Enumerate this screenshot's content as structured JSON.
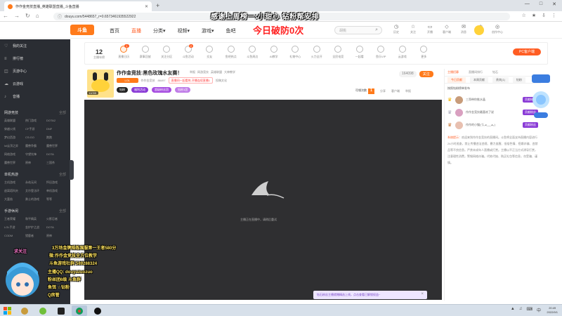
{
  "browser": {
    "tab_title": "作作金竞技直播_英雄联盟直播_斗鱼直播",
    "url": "douyu.com/5448657_r=0.6573461935522922",
    "url_prefix": "ⓘ",
    "new_tab": "+",
    "window_controls": [
      "—",
      "□",
      "✕"
    ],
    "nav": [
      "←",
      "→",
      "↻",
      "⌂"
    ],
    "right_icons": [
      "☆",
      "★",
      "⇩",
      "⋮"
    ]
  },
  "overlay": {
    "line1": "感谢上周榜一:小甜心   钻粉帮安排",
    "line2": "今日破防0次"
  },
  "header": {
    "logo": "斗鱼",
    "nav": [
      "首页",
      "直播",
      "分类▾",
      "视频▾",
      "游戏▾",
      "鱼吧"
    ],
    "active_nav": 1,
    "search_placeholder": "胡桃",
    "search_icon": "⌕",
    "icons": [
      {
        "glyph": "◷",
        "label": "历史"
      },
      {
        "glyph": "☆",
        "label": "关注"
      },
      {
        "glyph": "▭",
        "label": "开播"
      },
      {
        "glyph": "◇",
        "label": "客户端"
      },
      {
        "glyph": "✉",
        "label": "消息"
      },
      {
        "glyph": "♔",
        "label": "贵族"
      },
      {
        "glyph": "◎",
        "label": "创作中心"
      }
    ]
  },
  "sidebar": {
    "top": [
      {
        "icon": "♡",
        "label": "我的关注"
      },
      {
        "icon": "≡",
        "label": "排行榜"
      },
      {
        "icon": "◫",
        "label": "页游中心"
      },
      {
        "icon": "☁",
        "label": "云游戏"
      },
      {
        "icon": "♪",
        "label": "音播"
      }
    ],
    "sections": [
      {
        "title": "网游竞技",
        "more": "全部",
        "items": [
          "英雄联盟",
          "热门游戏",
          "DOTA2",
          "穿越火线",
          "CF手游",
          "DNF",
          "梦幻西游",
          "CS:GO",
          "跑跑",
          "lol云顶之弈",
          "魔兽争霸",
          "魔兽世界",
          "网络游戏",
          "守望先锋",
          "DOTA",
          "魔兽世界",
          "原神",
          "三国杀"
        ]
      },
      {
        "title": "单机热游",
        "more": "全部",
        "items": [
          "主机游戏",
          "永劫无间",
          "怀旧游戏",
          "逃离塔科夫",
          "艾尔登法环",
          "单机游戏",
          "大富翁",
          "勇士的游戏",
          "等等"
        ]
      },
      {
        "title": "手游休闲",
        "more": "全部",
        "items": [
          "王者荣耀",
          "和平精英",
          "火影忍者",
          "LOL手游",
          "金铲铲之战",
          "DOTA",
          "CODM",
          "猎鹿者",
          "原神"
        ]
      }
    ],
    "handle_glyph": "‹"
  },
  "categories": {
    "date_num": "12",
    "date_label": "主播年榜",
    "items": [
      {
        "label": "直播日历",
        "badge": "1"
      },
      {
        "label": "赛事回放",
        "badge": ""
      },
      {
        "label": "关注分区",
        "badge": ""
      },
      {
        "label": "斗鱼活动",
        "badge": "2"
      },
      {
        "label": "交友",
        "badge": ""
      },
      {
        "label": "鱼吧热点",
        "badge": ""
      },
      {
        "label": "斗鱼周边",
        "badge": ""
      },
      {
        "label": "AI教学",
        "badge": ""
      },
      {
        "label": "礼物中心",
        "badge": ""
      },
      {
        "label": "火力全开",
        "badge": ""
      },
      {
        "label": "全民电竞",
        "badge": ""
      },
      {
        "label": "一起看",
        "badge": ""
      },
      {
        "label": "鱼乐VIP",
        "badge": ""
      },
      {
        "label": "云游戏",
        "badge": ""
      },
      {
        "label": "更多",
        "badge": ""
      }
    ],
    "pc_button": "PC客户端"
  },
  "room": {
    "title": "作作金竞技:黑色玫瑰水友赛！",
    "meta": [
      "举报",
      "网游竞技",
      "英雄联盟",
      "大神教学"
    ],
    "category_pill": "LOL",
    "name": "作作金竞技",
    "fans": "86497",
    "red_tag": "直播间一起看热 开播连续直播1",
    "share_label": "投稿文化",
    "level": "LV.59",
    "badges": [
      "钻粉",
      "福利活动 ",
      "超级粉丝团",
      "钻粉1团"
    ],
    "follow_count": "164098",
    "follow_btn": "关注",
    "action_main": "可领次数",
    "action_main_num": "1",
    "actions": [
      "分享",
      "客户端",
      "举报"
    ]
  },
  "video": {
    "message": "主播正在直播中，请稍后重试",
    "tip": "钻石粉丝主播就赠精选上线，点击查看已解锁权益~",
    "tip_close": "×"
  },
  "chat": {
    "tabs": [
      "主播招募",
      "直播间排行",
      "钻石"
    ],
    "active_tab": 0,
    "tabs2": [
      "今日贡献",
      "本周贡献",
      "贵宾(1)",
      "钻粉"
    ],
    "active_tab2": 0,
    "rank_title": "按照钻粉榜单发布",
    "rows": [
      {
        "name": "三哥带你推水晶",
        "btn": "贡献粉丝"
      },
      {
        "name": "作作金竞技最喜欢了说",
        "btn": "贡献粉丝"
      },
      {
        "name": "作作的小猫(づ｡◕‿‿◕｡)",
        "btn": "贡献粉丝"
      }
    ],
    "system_label": "系统提示：",
    "system_text": "欢迎来到作作金竞技的直播间。斗鱼将全面支持直播内容进行24小时巡查，禁止传播违法违规、暴力血腥、低俗色情、招嫖诈骗、违禁品等不良信息。严禁未成年人直播或打赏。主播以不正当方式诱导打赏，注意理性消费，警惕网络诈骗。代练代抽、购买礼包等信息，勿受骗、谨慎。"
  },
  "streamer_overlay": {
    "lines": [
      "求关注",
      "3万场金牌陪练国服第一王者580分",
      "微:作作金竞技全方位教学",
      "斗鱼游戏社群:589288324",
      "主播QQ: douyuzuozuo",
      "粉丝团6级 斗鱼群",
      "鱼饵 ☆钻粉",
      "Q房管"
    ]
  },
  "taskbar": {
    "time": "20:49",
    "date": "2022/9/1",
    "tray": [
      "▲",
      "♫",
      "⌨",
      "中"
    ]
  },
  "colors": {
    "brand": "#ff7a1a",
    "accent": "#ff5d23",
    "sidebar": "#2a2d33",
    "video_bg": "#2f2f31",
    "overlay_red": "#ff2020"
  }
}
